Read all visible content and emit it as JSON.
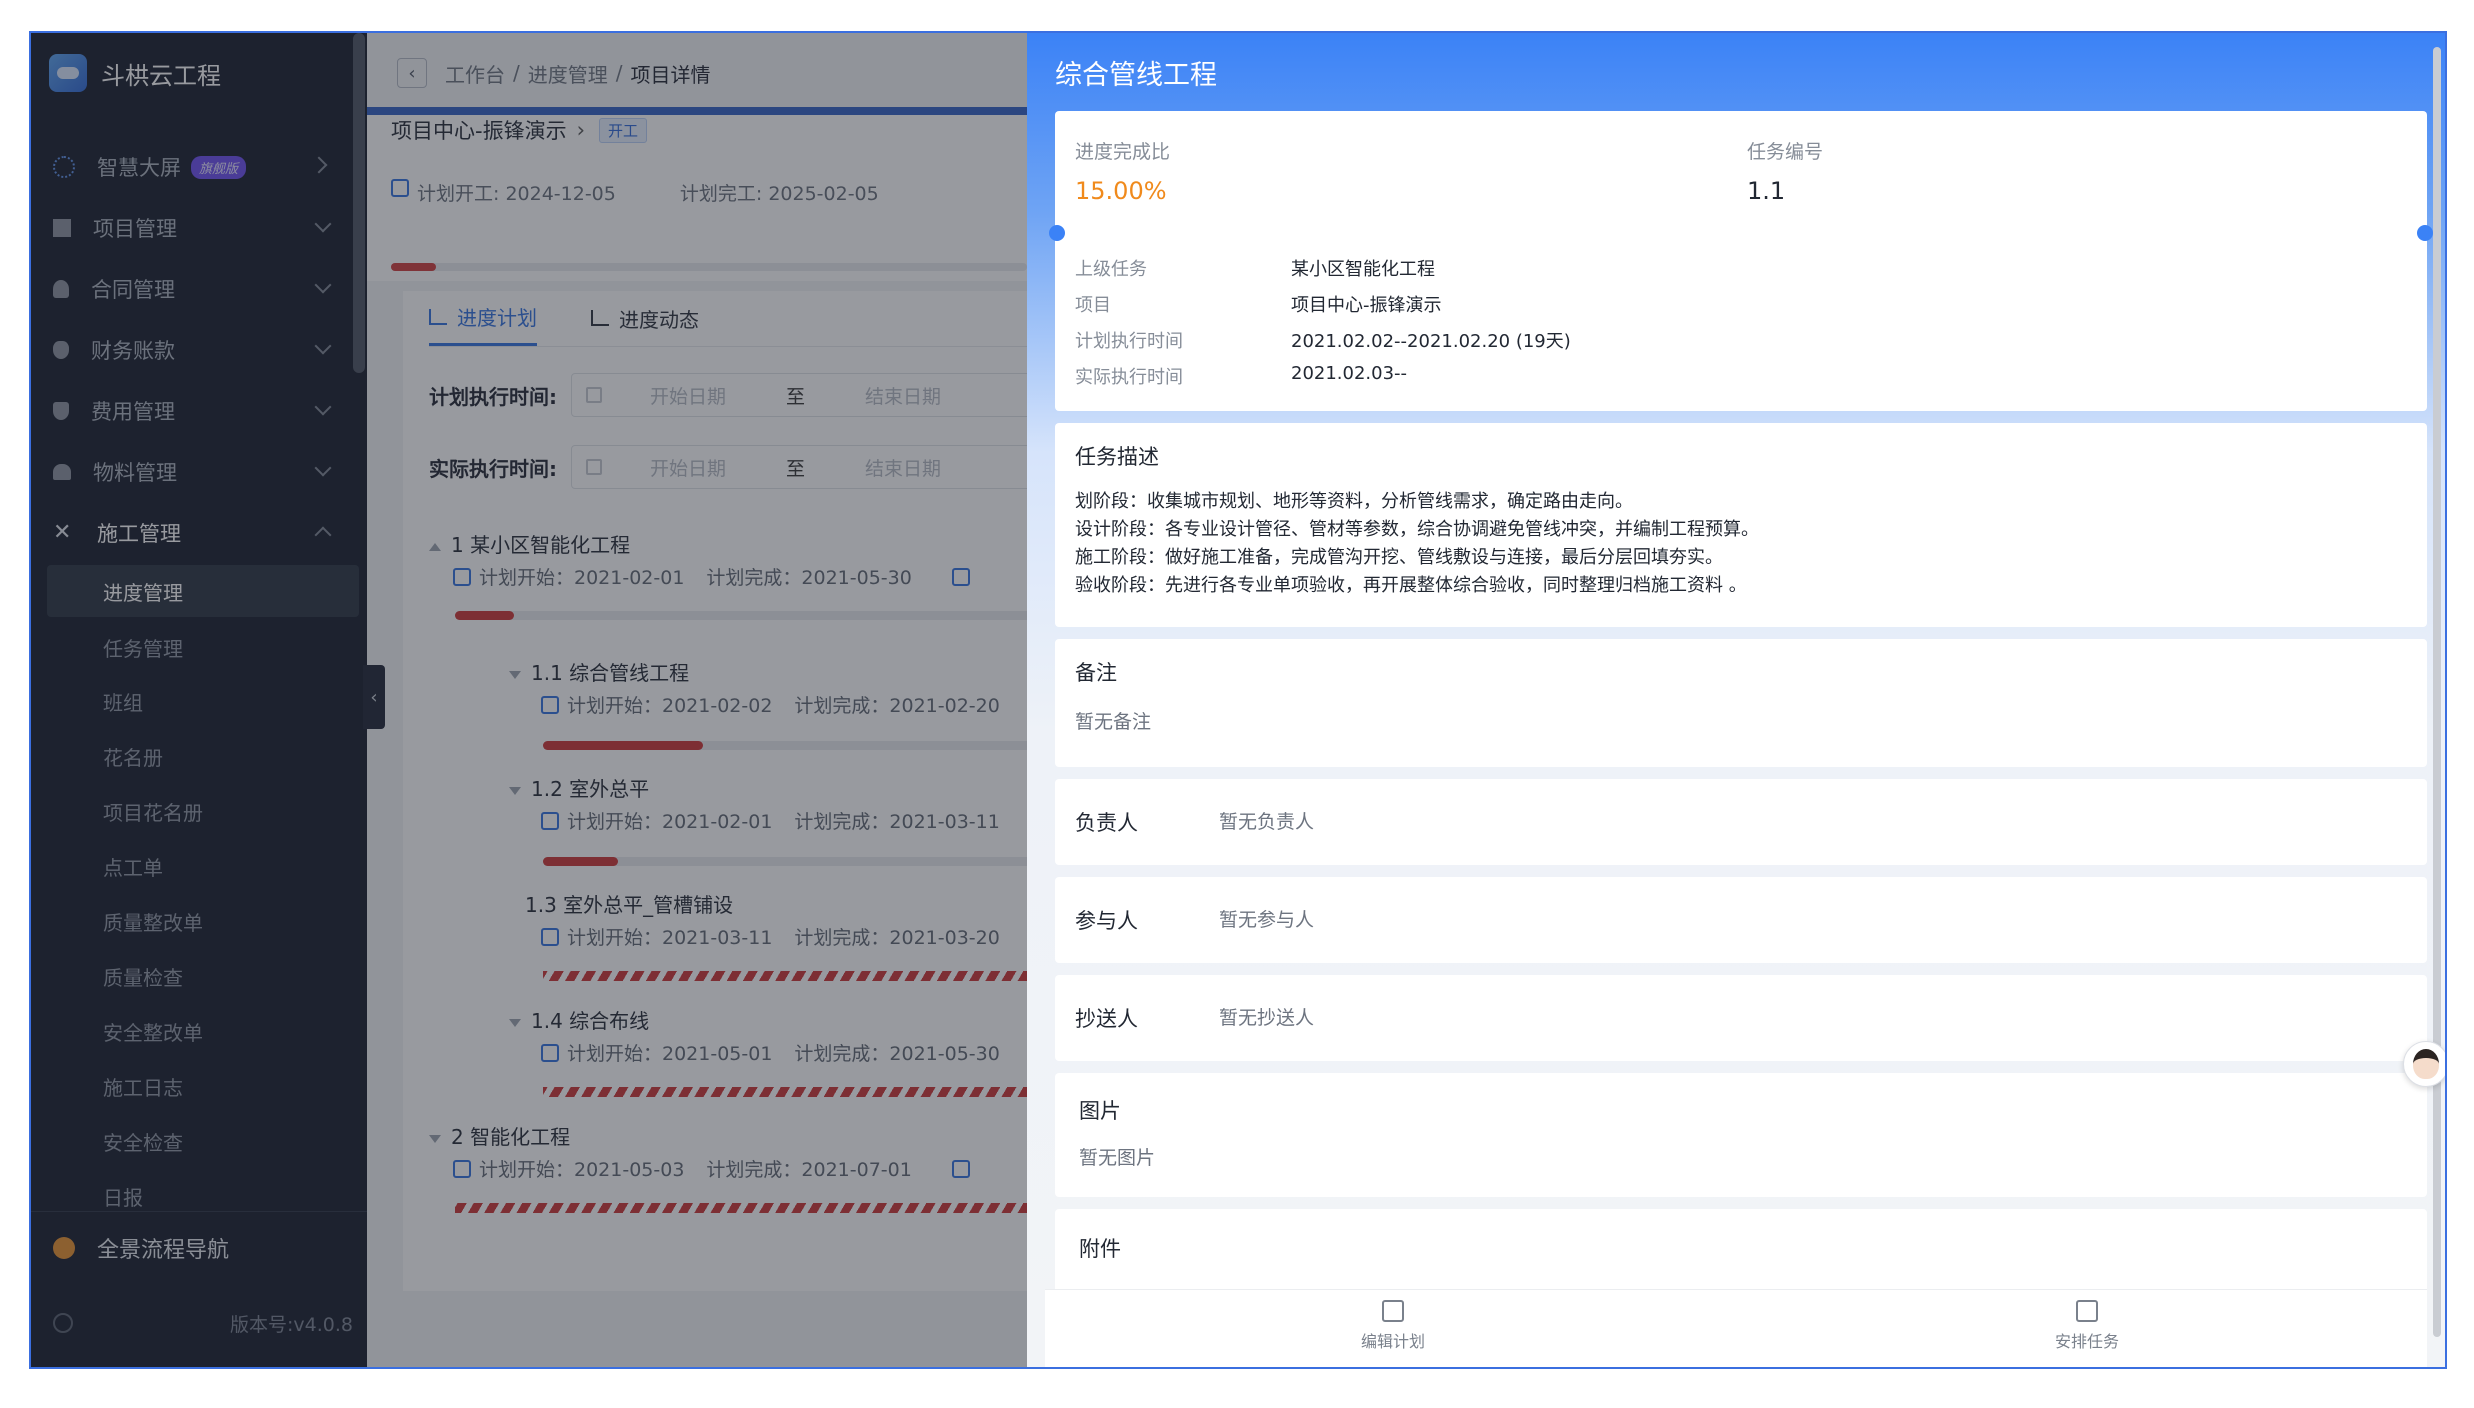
{
  "app": {
    "brand": "斗栱云工程"
  },
  "sidebar": {
    "menu": [
      {
        "label": "智慧大屏",
        "badge": "旗舰版"
      },
      {
        "label": "项目管理"
      },
      {
        "label": "合同管理"
      },
      {
        "label": "财务账款"
      },
      {
        "label": "费用管理"
      },
      {
        "label": "物料管理"
      },
      {
        "label": "施工管理"
      }
    ],
    "sub_items": [
      "进度管理",
      "任务管理",
      "班组",
      "花名册",
      "项目花名册",
      "点工单",
      "质量整改单",
      "质量检查",
      "安全整改单",
      "施工日志",
      "安全检查",
      "日报"
    ],
    "nav_link": "全景流程导航",
    "version": "版本号:v4.0.8",
    "collapse_glyph": "‹"
  },
  "breadcrumb": {
    "items": [
      "工作台",
      "进度管理",
      "项目详情"
    ],
    "sep": "/"
  },
  "project": {
    "name": "项目中心-振锋演示",
    "status_tag": "开工",
    "plan_start": "计划开工: 2024-12-05",
    "plan_end": "计划完工: 2025-02-05",
    "progress": 0.07
  },
  "schedule": {
    "tabs": [
      "进度计划",
      "进度动态"
    ],
    "filters": [
      {
        "label": "计划执行时间:",
        "start_placeholder": "开始日期",
        "to": "至",
        "end_placeholder": "结束日期"
      },
      {
        "label": "实际执行时间:",
        "start_placeholder": "开始日期",
        "to": "至",
        "end_placeholder": "结束日期"
      }
    ],
    "tasks": [
      {
        "title": "1 某小区智能化工程",
        "plan_start": "计划开始：2021-02-01",
        "plan_end": "计划完成：2021-05-30",
        "progress": 0.1
      },
      {
        "title": "1.1 综合管线工程",
        "plan_start": "计划开始：2021-02-02",
        "plan_end": "计划完成：2021-02-20",
        "progress": 0.32
      },
      {
        "title": "1.2 室外总平",
        "plan_start": "计划开始：2021-02-01",
        "plan_end": "计划完成：2021-03-11",
        "progress": 0.15
      },
      {
        "title": "1.3 室外总平_管槽铺设",
        "plan_start": "计划开始：2021-03-11",
        "plan_end": "计划完成：2021-03-20"
      },
      {
        "title": "1.4 综合布线",
        "plan_start": "计划开始：2021-05-01",
        "plan_end": "计划完成：2021-05-30"
      },
      {
        "title": "2 智能化工程",
        "plan_start": "计划开始：2021-05-03",
        "plan_end": "计划完成：2021-07-01"
      }
    ]
  },
  "drawer": {
    "title": "综合管线工程",
    "progress_label": "进度完成比",
    "progress_value": "15.00%",
    "task_no_label": "任务编号",
    "task_no": "1.1",
    "fields": [
      {
        "label": "上级任务",
        "value": "某小区智能化工程"
      },
      {
        "label": "项目",
        "value": "项目中心-振锋演示"
      },
      {
        "label": "计划执行时间",
        "value": "2021.02.02--2021.02.20 (19天)"
      },
      {
        "label": "实际执行时间",
        "value": "2021.02.03--"
      }
    ],
    "desc_title": "任务描述",
    "desc_lines": [
      "划阶段：收集城市规划、地形等资料，分析管线需求，确定路由走向。",
      "设计阶段：各专业设计管径、管材等参数，综合协调避免管线冲突，并编制工程预算。",
      "施工阶段：做好施工准备，完成管沟开挖、管线敷设与连接，最后分层回填夯实。",
      "验收阶段：先进行各专业单项验收，再开展整体综合验收，同时整理归档施工资料 。"
    ],
    "remark_title": "备注",
    "remark_value": "暂无备注",
    "people": [
      {
        "label": "负责人",
        "value": "暂无负责人"
      },
      {
        "label": "参与人",
        "value": "暂无参与人"
      },
      {
        "label": "抄送人",
        "value": "暂无抄送人"
      }
    ],
    "image_title": "图片",
    "image_value": "暂无图片",
    "attach_title": "附件",
    "footer": {
      "edit": "编辑计划",
      "assign": "安排任务"
    }
  }
}
